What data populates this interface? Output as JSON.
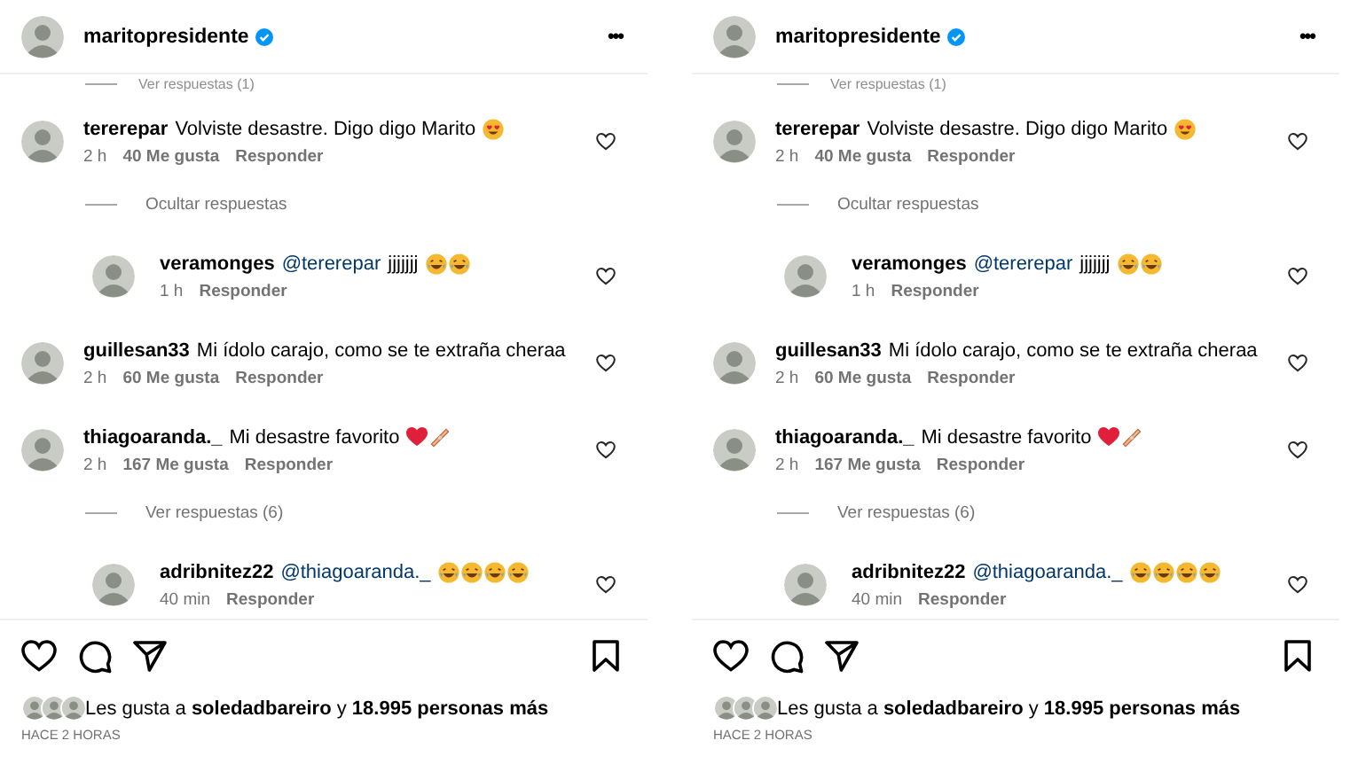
{
  "panels": [
    {
      "header": {
        "username": "maritopresidente",
        "verified": true,
        "menu": "•••"
      },
      "top_link": "Ver respuestas (1)",
      "items": [
        {
          "kind": "comment",
          "user": "tererepar",
          "text": "Volviste desastre. Digo digo Marito",
          "emojis": [
            {
              "kind": "heart-eyes"
            }
          ],
          "time": "2 h",
          "likes": "40 Me gusta",
          "reply": "Responder"
        },
        {
          "kind": "toggle",
          "text": "Ocultar respuestas"
        },
        {
          "kind": "reply",
          "user": "veramonges",
          "mention": "@tererepar",
          "text": "jjjjjjj",
          "emojis": [
            {
              "kind": "laughing"
            },
            {
              "kind": "laughing"
            }
          ],
          "time": "1 h",
          "reply": "Responder"
        },
        {
          "kind": "comment",
          "user": "guillesan33",
          "text": "Mi ídolo carajo, como se te extraña cheraa",
          "time": "2 h",
          "likes": "60 Me gusta",
          "reply": "Responder"
        },
        {
          "kind": "comment",
          "user": "thiagoaranda._",
          "text": "Mi desastre favorito",
          "emojis": [
            {
              "kind": "heart"
            },
            {
              "kind": "bandage"
            }
          ],
          "time": "2 h",
          "likes": "167 Me gusta",
          "reply": "Responder"
        },
        {
          "kind": "toggle",
          "text": "Ver respuestas (6)"
        },
        {
          "kind": "reply",
          "user": "adribnitez22",
          "mention": "@thiagoaranda._",
          "emojis": [
            {
              "kind": "laughing"
            },
            {
              "kind": "laughing"
            },
            {
              "kind": "laughing"
            },
            {
              "kind": "laughing"
            }
          ],
          "time": "40 min",
          "reply": "Responder"
        }
      ],
      "likes": "Les gusta a **soledadbareiro** y **18.995 personas más**",
      "posted": "HACE 2 HORAS"
    },
    {
      "header": {
        "username": "maritopresidente",
        "verified": true,
        "menu": "•••"
      },
      "top_link": "Ver respuestas (1)",
      "items": [
        {
          "kind": "comment",
          "user": "tererepar",
          "text": "Volviste desastre. Digo digo Marito",
          "emojis": [
            {
              "kind": "heart-eyes"
            }
          ],
          "time": "2 h",
          "likes": "40 Me gusta",
          "reply": "Responder"
        },
        {
          "kind": "toggle",
          "text": "Ocultar respuestas"
        },
        {
          "kind": "reply",
          "user": "veramonges",
          "mention": "@tererepar",
          "text": "jjjjjjj",
          "emojis": [
            {
              "kind": "laughing"
            },
            {
              "kind": "laughing"
            }
          ],
          "time": "1 h",
          "reply": "Responder"
        },
        {
          "kind": "comment",
          "user": "guillesan33",
          "text": "Mi ídolo carajo, como se te extraña cheraa",
          "time": "2 h",
          "likes": "60 Me gusta",
          "reply": "Responder"
        },
        {
          "kind": "comment",
          "user": "thiagoaranda._",
          "text": "Mi desastre favorito",
          "emojis": [
            {
              "kind": "heart"
            },
            {
              "kind": "bandage"
            }
          ],
          "time": "2 h",
          "likes": "167 Me gusta",
          "reply": "Responder"
        },
        {
          "kind": "toggle",
          "text": "Ver respuestas (6)"
        },
        {
          "kind": "reply",
          "user": "adribnitez22",
          "mention": "@thiagoaranda._",
          "emojis": [
            {
              "kind": "laughing"
            },
            {
              "kind": "laughing"
            },
            {
              "kind": "laughing"
            },
            {
              "kind": "laughing"
            }
          ],
          "time": "40 min",
          "reply": "Responder"
        }
      ],
      "likes": "Les gusta a **soledadbareiro** y **18.995 personas más**",
      "posted": "HACE 2 HORAS"
    }
  ]
}
